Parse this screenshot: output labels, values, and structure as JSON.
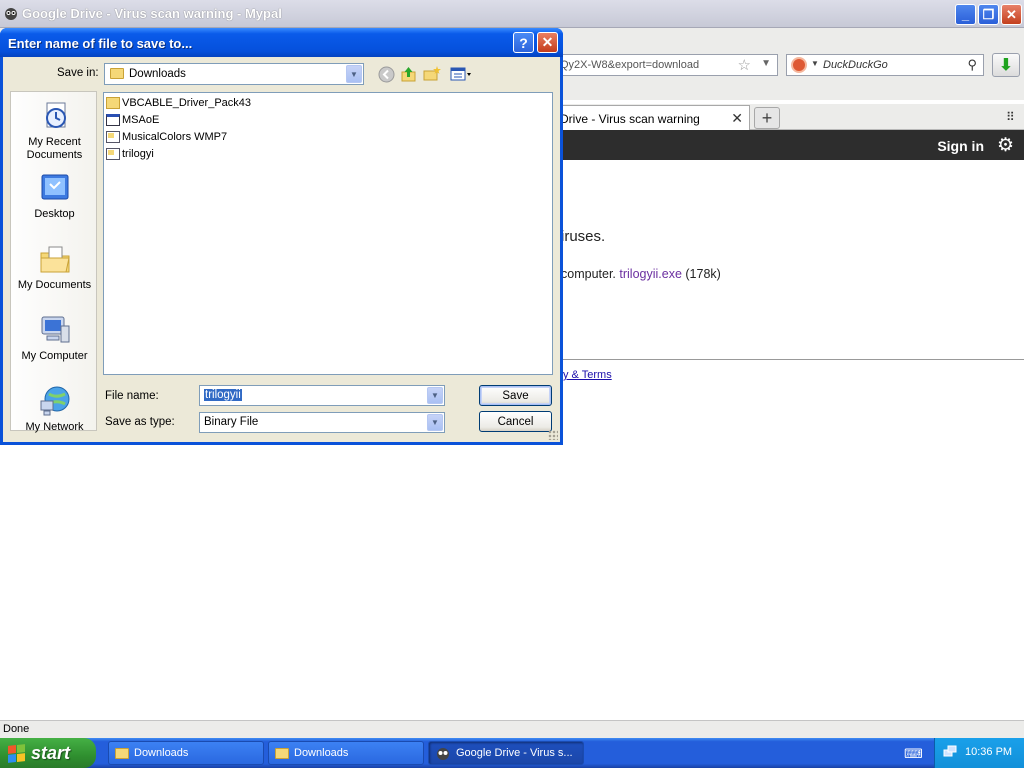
{
  "browser": {
    "window_title": "Google Drive - Virus scan warning - Mypal",
    "url_fragment": "Qy2X-W8&export=download",
    "search_engine": "DuckDuckGo",
    "tab_title": "Drive - Virus scan warning",
    "signin_label": "Sign in",
    "content": {
      "heading_fragment": "iruses.",
      "line_fragment": "computer. ",
      "link_text": "trilogyii.exe",
      "size_text": " (178k)",
      "terms_fragment": "y & Terms"
    },
    "status": "Done"
  },
  "dialog": {
    "title": "Enter name of file to save to...",
    "save_in_label": "Save in:",
    "save_in_value": "Downloads",
    "places": [
      {
        "label": "My Recent Documents",
        "icon": "recent-documents-icon"
      },
      {
        "label": "Desktop",
        "icon": "desktop-icon"
      },
      {
        "label": "My Documents",
        "icon": "my-documents-icon"
      },
      {
        "label": "My Computer",
        "icon": "my-computer-icon"
      },
      {
        "label": "My Network",
        "icon": "my-network-icon"
      }
    ],
    "files": [
      {
        "name": "VBCABLE_Driver_Pack43",
        "type": "folder"
      },
      {
        "name": "MSAoE",
        "type": "application"
      },
      {
        "name": "MusicalColors WMP7",
        "type": "executable"
      },
      {
        "name": "trilogyi",
        "type": "executable"
      }
    ],
    "file_name_label": "File name:",
    "file_name_value": "trilogyii",
    "save_type_label": "Save as type:",
    "save_type_value": "Binary File",
    "save_button": "Save",
    "cancel_button": "Cancel"
  },
  "taskbar": {
    "start_label": "start",
    "tasks": [
      {
        "label": "Downloads"
      },
      {
        "label": "Downloads"
      },
      {
        "label": "Google Drive - Virus s..."
      }
    ],
    "clock": "10:36 PM"
  },
  "colors": {
    "xp_blue": "#0a52d9",
    "dialog_face": "#ece9d8",
    "start_green": "#2f8f2f",
    "selection": "#316ac5"
  }
}
